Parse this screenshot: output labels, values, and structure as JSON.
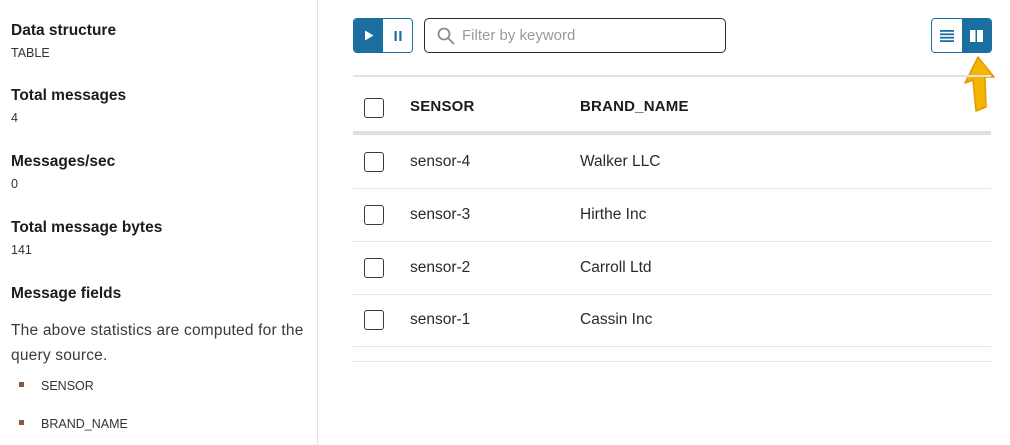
{
  "sidebar": {
    "stats": [
      {
        "label": "Data structure",
        "value": "TABLE"
      },
      {
        "label": "Total messages",
        "value": "4"
      },
      {
        "label": "Messages/sec",
        "value": "0"
      },
      {
        "label": "Total message bytes",
        "value": "141"
      }
    ],
    "fields_heading": "Message fields",
    "description": "The above statistics are computed for the query source.",
    "fields": [
      "SENSOR",
      "BRAND_NAME"
    ]
  },
  "toolbar": {
    "play_icon": "play-icon",
    "pause_icon": "pause-icon",
    "search_placeholder": "Filter by keyword",
    "search_value": "",
    "list_view_icon": "list-view-icon",
    "split_view_icon": "split-view-icon",
    "accent_color": "#1a6fa0"
  },
  "table": {
    "columns": [
      "SENSOR",
      "BRAND_NAME"
    ],
    "rows": [
      [
        "sensor-4",
        "Walker LLC"
      ],
      [
        "sensor-3",
        "Hirthe Inc"
      ],
      [
        "sensor-2",
        "Carroll Ltd"
      ],
      [
        "sensor-1",
        "Cassin Inc"
      ]
    ]
  }
}
